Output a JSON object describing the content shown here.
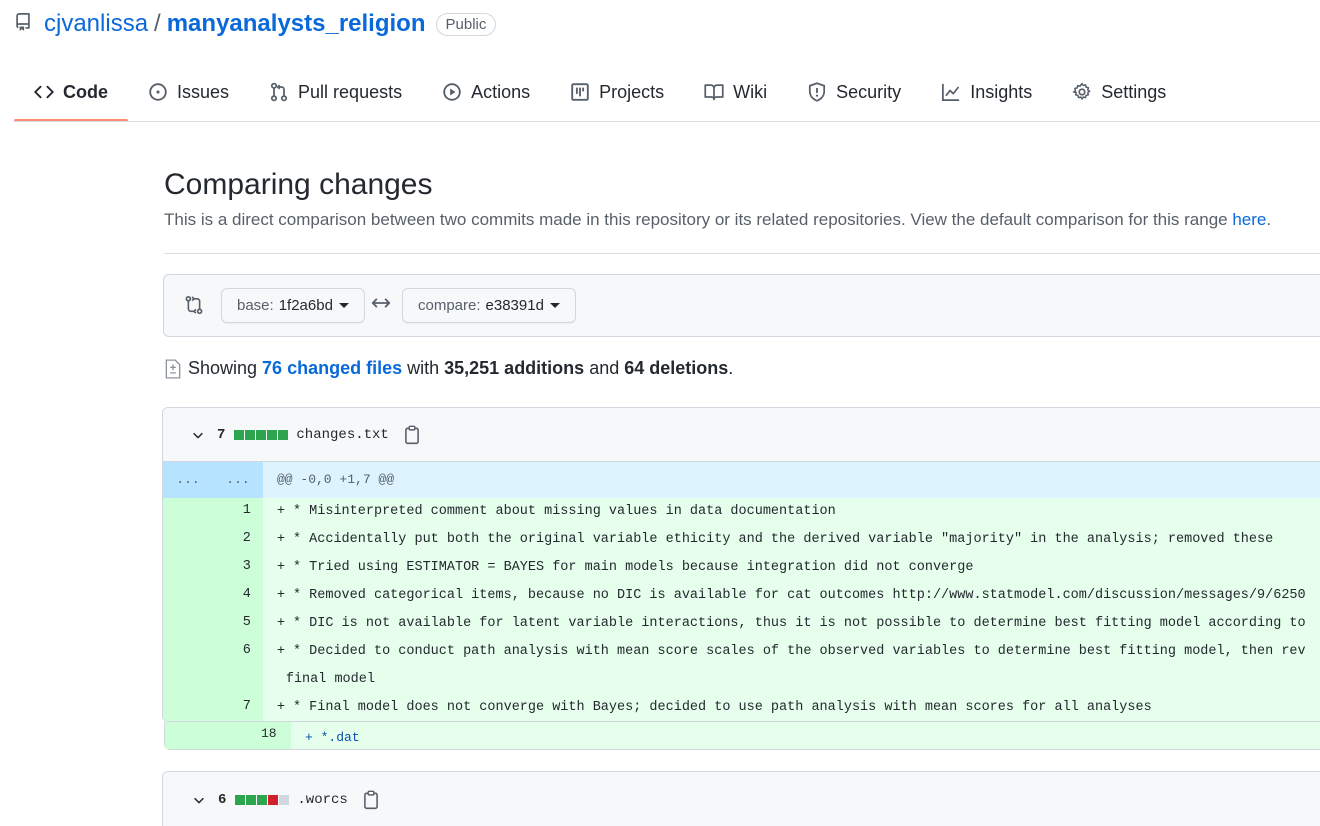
{
  "repo": {
    "owner": "cjvanlissa",
    "separator": "/",
    "name": "manyanalysts_religion",
    "visibility": "Public"
  },
  "tabs": [
    {
      "label": "Code",
      "icon": "code-icon",
      "selected": true
    },
    {
      "label": "Issues",
      "icon": "issue-icon"
    },
    {
      "label": "Pull requests",
      "icon": "pull-request-icon"
    },
    {
      "label": "Actions",
      "icon": "play-icon"
    },
    {
      "label": "Projects",
      "icon": "project-icon"
    },
    {
      "label": "Wiki",
      "icon": "book-icon"
    },
    {
      "label": "Security",
      "icon": "shield-icon"
    },
    {
      "label": "Insights",
      "icon": "graph-icon"
    },
    {
      "label": "Settings",
      "icon": "gear-icon"
    }
  ],
  "compare": {
    "title": "Comparing changes",
    "subtitle": "This is a direct comparison between two commits made in this repository or its related repositories. View the default comparison for this range",
    "subtitle_link": "here",
    "subtitle_end": ".",
    "base_label": "base:",
    "base_value": "1f2a6bd",
    "compare_label": "compare:",
    "compare_value": "e38391d"
  },
  "summary": {
    "prefix": "Showing",
    "files_link": "76 changed files",
    "with": "with",
    "additions": "35,251 additions",
    "and": "and",
    "deletions": "64 deletions",
    "end": "."
  },
  "files": [
    {
      "count": "7",
      "name": "changes.txt",
      "diffstat": [
        "#2da44e",
        "#2da44e",
        "#2da44e",
        "#2da44e",
        "#2da44e"
      ],
      "hunk_gutter_left": "...",
      "hunk_gutter_right": "...",
      "hunk_header": "@@ -0,0 +1,7 @@",
      "lines": [
        {
          "num": "1",
          "text": "* Misinterpreted comment about missing values in data documentation"
        },
        {
          "num": "2",
          "text": "* Accidentally put both the original variable ethicity and the derived variable \"majority\" in the analysis; removed these"
        },
        {
          "num": "3",
          "text": "* Tried using ESTIMATOR = BAYES for main models because integration did not converge"
        },
        {
          "num": "4",
          "text": "* Removed categorical items, because no DIC is available for cat outcomes http://www.statmodel.com/discussion/messages/9/6250"
        },
        {
          "num": "5",
          "text": "* DIC is not available for latent variable interactions, thus it is not possible to determine best fitting model according to"
        },
        {
          "num": "6",
          "text": "* Decided to conduct path analysis with mean score scales of the observed variables to determine best fitting model, then rev",
          "text2": "final model"
        },
        {
          "num": "7",
          "text": "* Final model does not converge with Bayes; decided to use path analysis with mean scores for all analyses"
        }
      ]
    },
    {
      "count": "6",
      "name": ".worcs",
      "diffstat": [
        "#2da44e",
        "#2da44e",
        "#2da44e",
        "#cf222e",
        "#d0d7de"
      ]
    }
  ],
  "peek": {
    "num": "18",
    "text": "+ *.dat"
  }
}
